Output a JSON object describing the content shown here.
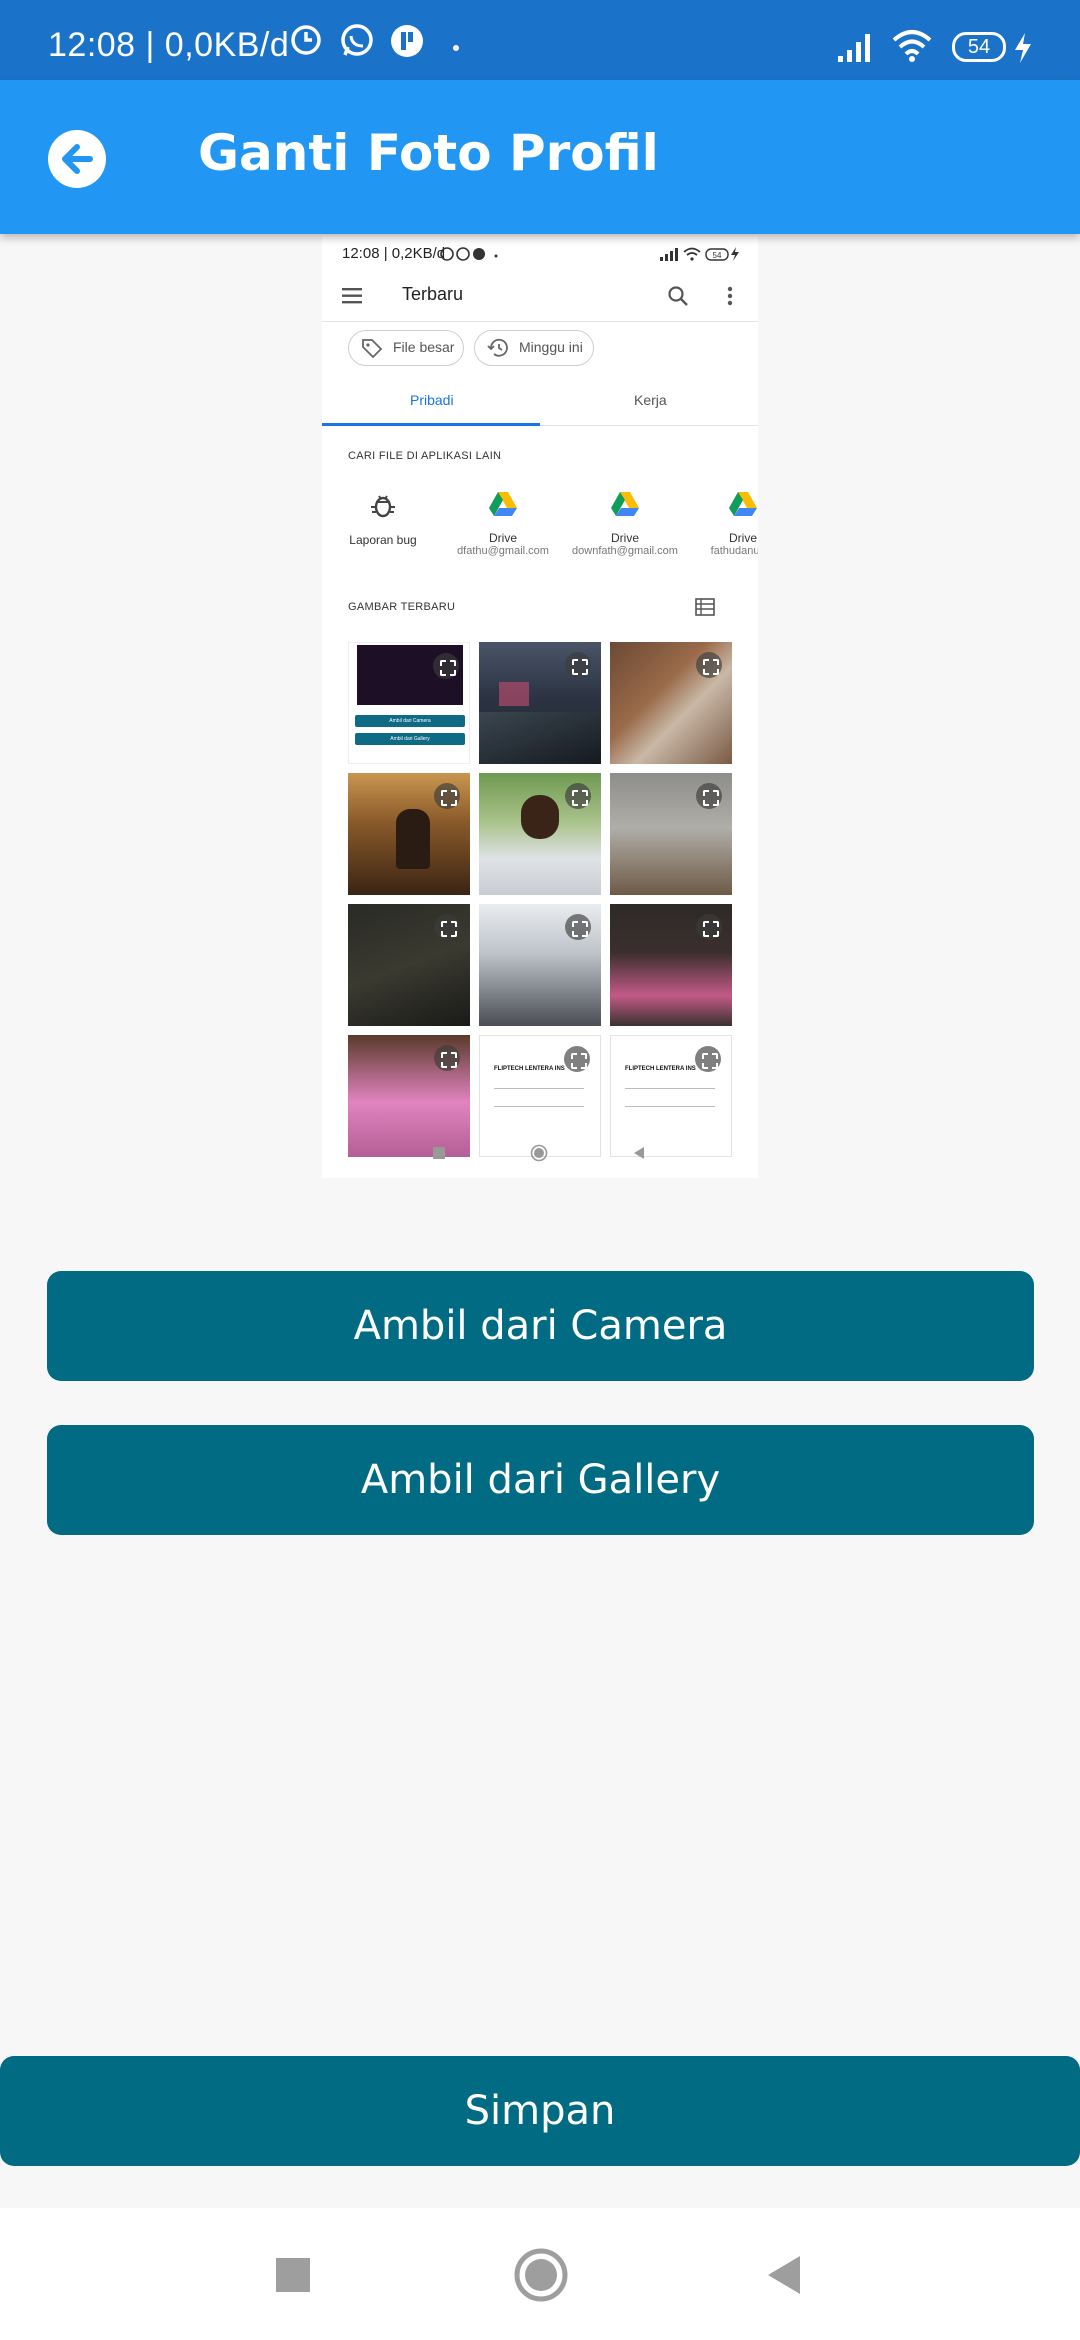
{
  "status_bar": {
    "time": "12:08 | 0,0KB/d",
    "battery": "54"
  },
  "app_bar": {
    "title": "Ganti Foto Profil"
  },
  "preview": {
    "status_time": "12:08 | 0,2KB/d",
    "status_battery": "54",
    "toolbar_title": "Terbaru",
    "chips": [
      "File besar",
      "Minggu ini"
    ],
    "tabs": [
      "Pribadi",
      "Kerja"
    ],
    "section_other_apps": "CARI FILE DI APLIKASI LAIN",
    "apps": [
      {
        "label": "Laporan bug",
        "sub": ""
      },
      {
        "label": "Drive",
        "sub": "dfathu@gmail.com"
      },
      {
        "label": "Drive",
        "sub": "downfath@gmail.com"
      },
      {
        "label": "Drive",
        "sub": "fathudanur.pr"
      }
    ],
    "section_recent_images": "GAMBAR TERBARU",
    "thumb_buttons": [
      "Ambil dari Camera",
      "Ambil dari Gallery"
    ],
    "receipt_title": "FLIPTECH LENTERA INS"
  },
  "buttons": {
    "camera": "Ambil dari Camera",
    "gallery": "Ambil dari Gallery",
    "save": "Simpan"
  },
  "colors": {
    "status_bar": "#1a73c8",
    "app_bar": "#2196f3",
    "button": "#006b83",
    "background": "#f7f7f7"
  }
}
